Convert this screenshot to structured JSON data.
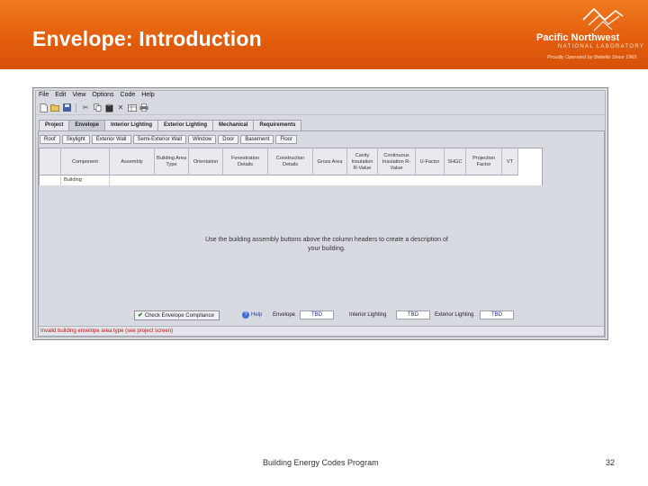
{
  "slide": {
    "title": "Envelope: Introduction",
    "logo": {
      "name": "Pacific Northwest",
      "subtitle": "NATIONAL LABORATORY",
      "tagline": "Proudly Operated by Battelle Since 1965"
    },
    "footer_text": "Building Energy Codes Program",
    "page_number": "32"
  },
  "app": {
    "menu": [
      {
        "label": "File"
      },
      {
        "label": "Edit"
      },
      {
        "label": "View"
      },
      {
        "label": "Options"
      },
      {
        "label": "Code"
      },
      {
        "label": "Help"
      }
    ],
    "toolbar": {
      "icons": [
        "new-file-icon",
        "open-folder-icon",
        "save-icon",
        "cut-icon",
        "copy-icon",
        "paste-icon",
        "delete-icon",
        "table-icon",
        "print-icon"
      ]
    },
    "main_tabs": [
      {
        "label": "Project",
        "active": false
      },
      {
        "label": "Envelope",
        "active": true
      },
      {
        "label": "Interior Lighting",
        "active": false
      },
      {
        "label": "Exterior Lighting",
        "active": false
      },
      {
        "label": "Mechanical",
        "active": false
      },
      {
        "label": "Requirements",
        "active": false
      }
    ],
    "assembly_buttons": [
      {
        "label": "Roof"
      },
      {
        "label": "Skylight"
      },
      {
        "label": "Exterior Wall"
      },
      {
        "label": "Semi-Exterior Wall"
      },
      {
        "label": "Window"
      },
      {
        "label": "Door"
      },
      {
        "label": "Basement"
      },
      {
        "label": "Floor"
      }
    ],
    "table": {
      "columns": [
        {
          "label": ""
        },
        {
          "label": "Component"
        },
        {
          "label": "Assembly"
        },
        {
          "label": "Building Area Type"
        },
        {
          "label": "Orientation"
        },
        {
          "label": "Fenestration Details"
        },
        {
          "label": "Construction Details"
        },
        {
          "label": "Gross Area"
        },
        {
          "label": "Cavity Insulation R-Value"
        },
        {
          "label": "Continuous Insulation R-Value"
        },
        {
          "label": "U-Factor"
        },
        {
          "label": "SHGC"
        },
        {
          "label": "Projection Factor"
        },
        {
          "label": "VT"
        }
      ],
      "rows": [
        {
          "component": "Building"
        }
      ]
    },
    "hint": "Use the building assembly buttons above the column headers to create a description of your building.",
    "bottom": {
      "check_button": "Check Envelope Compliance",
      "help_link": "Help",
      "envelope_label": "Envelope",
      "envelope_value": "TBD",
      "interior_label": "Interior Lighting",
      "interior_value": "TBD",
      "exterior_label": "Exterior Lighting",
      "exterior_value": "TBD"
    },
    "status": "Invalid building envelope area type (see project screen)"
  },
  "colors": {
    "header_orange": "#e25c0c",
    "status_red": "#c41010",
    "help_blue": "#1e3fa8"
  }
}
